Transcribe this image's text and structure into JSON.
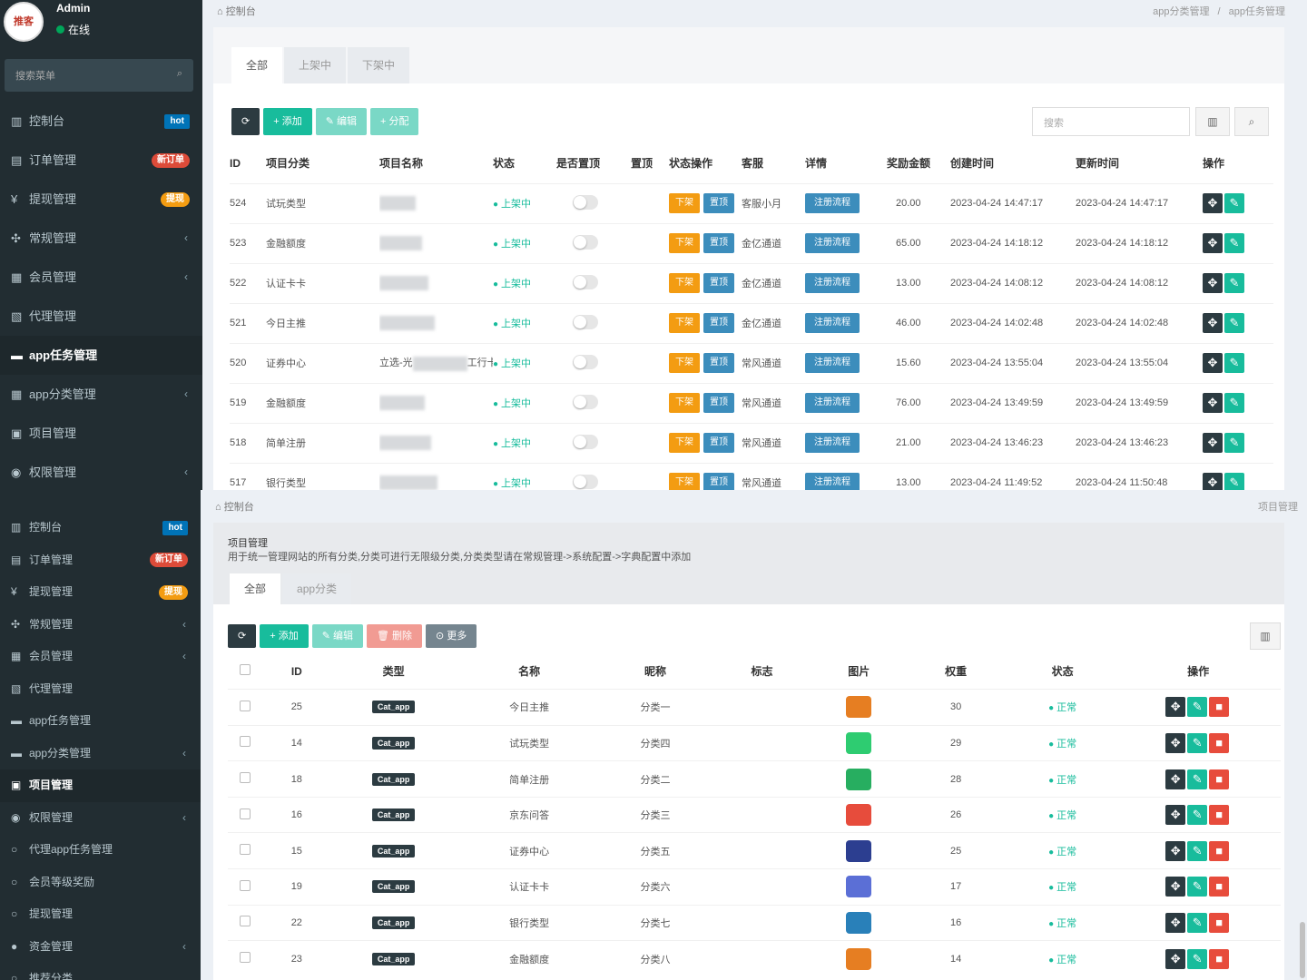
{
  "top": {
    "sidebar": {
      "avatar_text": "推客",
      "user_name": "Admin",
      "user_status": "在线",
      "search_placeholder": "搜索菜单",
      "items": [
        {
          "icon": "▥",
          "label": "控制台",
          "badge": "hot",
          "badge_kind": "hot"
        },
        {
          "icon": "▤",
          "label": "订单管理",
          "badge": "新订单",
          "badge_kind": "red"
        },
        {
          "icon": "¥",
          "label": "提现管理",
          "badge": "提现",
          "badge_kind": "orange"
        },
        {
          "icon": "✣",
          "label": "常规管理",
          "chevron": "‹"
        },
        {
          "icon": "▦",
          "label": "会员管理",
          "chevron": "‹"
        },
        {
          "icon": "▧",
          "label": "代理管理"
        },
        {
          "icon": "▬",
          "label": "app任务管理",
          "active": true
        },
        {
          "icon": "▦",
          "label": "app分类管理",
          "chevron": "‹"
        },
        {
          "icon": "▣",
          "label": "项目管理"
        },
        {
          "icon": "◉",
          "label": "权限管理",
          "chevron": "‹"
        }
      ]
    },
    "breadcrumb": "控制台",
    "breadcrumb_right": [
      "app分类管理",
      "/",
      "app任务管理"
    ],
    "tabs": [
      "全部",
      "上架中",
      "下架中"
    ],
    "toolbar": [
      "⟳",
      "+ 添加",
      "✎ 编辑",
      "+ 分配"
    ],
    "search_placeholder": "搜索",
    "columns": [
      "ID",
      "项目分类",
      "项目名称",
      "状态",
      "是否置顶",
      "置顶",
      "状态操作",
      "客服",
      "详情",
      "奖励金额",
      "创建时间",
      "更新时间",
      "操作"
    ],
    "rows": [
      {
        "id": "524",
        "category": "试玩类型",
        "status": "上架中",
        "down": "下架",
        "top": "置顶",
        "service": "客服小月",
        "detail": "注册流程",
        "amount": "20.00",
        "created": "2023-04-24 14:47:17",
        "updated": "2023-04-24 14:47:17"
      },
      {
        "id": "523",
        "category": "金融额度",
        "status": "上架中",
        "down": "下架",
        "top": "置顶",
        "service": "金亿通道",
        "detail": "注册流程",
        "amount": "65.00",
        "created": "2023-04-24 14:18:12",
        "updated": "2023-04-24 14:18:12"
      },
      {
        "id": "522",
        "category": "认证卡卡",
        "status": "上架中",
        "down": "下架",
        "top": "置顶",
        "service": "金亿通道",
        "detail": "注册流程",
        "amount": "13.00",
        "created": "2023-04-24 14:08:12",
        "updated": "2023-04-24 14:08:12"
      },
      {
        "id": "521",
        "category": "今日主推",
        "status": "上架中",
        "down": "下架",
        "top": "置顶",
        "service": "金亿通道",
        "detail": "注册流程",
        "amount": "46.00",
        "created": "2023-04-24 14:02:48",
        "updated": "2023-04-24 14:02:48"
      },
      {
        "id": "520",
        "category": "证券中心",
        "name_prefix": "立选-光",
        "name_suffix": "工行卡",
        "status": "上架中",
        "down": "下架",
        "top": "置顶",
        "service": "常风通道",
        "detail": "注册流程",
        "amount": "15.60",
        "created": "2023-04-24 13:55:04",
        "updated": "2023-04-24 13:55:04"
      },
      {
        "id": "519",
        "category": "金融额度",
        "status": "上架中",
        "down": "下架",
        "top": "置顶",
        "service": "常风通道",
        "detail": "注册流程",
        "amount": "76.00",
        "created": "2023-04-24 13:49:59",
        "updated": "2023-04-24 13:49:59"
      },
      {
        "id": "518",
        "category": "简单注册",
        "status": "上架中",
        "down": "下架",
        "top": "置顶",
        "service": "常风通道",
        "detail": "注册流程",
        "amount": "21.00",
        "created": "2023-04-24 13:46:23",
        "updated": "2023-04-24 13:46:23"
      },
      {
        "id": "517",
        "category": "银行类型",
        "status": "上架中",
        "down": "下架",
        "top": "置顶",
        "service": "常风通道",
        "detail": "注册流程",
        "amount": "13.00",
        "created": "2023-04-24 11:49:52",
        "updated": "2023-04-24 11:50:48"
      }
    ]
  },
  "bottom": {
    "sidebar": {
      "items": [
        {
          "icon": "▥",
          "label": "控制台",
          "badge": "hot",
          "badge_kind": "hot"
        },
        {
          "icon": "▤",
          "label": "订单管理",
          "badge": "新订单",
          "badge_kind": "red"
        },
        {
          "icon": "¥",
          "label": "提现管理",
          "badge": "提现",
          "badge_kind": "orange"
        },
        {
          "icon": "✣",
          "label": "常规管理",
          "chevron": "‹"
        },
        {
          "icon": "▦",
          "label": "会员管理",
          "chevron": "‹"
        },
        {
          "icon": "▧",
          "label": "代理管理"
        },
        {
          "icon": "▬",
          "label": "app任务管理"
        },
        {
          "icon": "▬",
          "label": "app分类管理",
          "chevron": "‹"
        },
        {
          "icon": "▣",
          "label": "项目管理",
          "active": true
        },
        {
          "icon": "◉",
          "label": "权限管理",
          "chevron": "‹"
        },
        {
          "icon": "○",
          "label": "代理app任务管理"
        },
        {
          "icon": "○",
          "label": "会员等级奖励"
        },
        {
          "icon": "○",
          "label": "提现管理"
        },
        {
          "icon": "●",
          "label": "资金管理",
          "chevron": "‹"
        },
        {
          "icon": "○",
          "label": "推荐分类"
        }
      ]
    },
    "breadcrumb": "控制台",
    "breadcrumb_right": "项目管理",
    "desc_title": "项目管理",
    "desc_text": "用于统一管理网站的所有分类,分类可进行无限级分类,分类类型请在常规管理->系统配置->字典配置中添加",
    "tabs": [
      "全部",
      "app分类"
    ],
    "toolbar": [
      "⟳",
      "+ 添加",
      "✎ 编辑",
      "🗑 删除",
      "⊙ 更多"
    ],
    "columns": [
      "",
      "ID",
      "类型",
      "名称",
      "昵称",
      "标志",
      "图片",
      "权重",
      "状态",
      "操作"
    ],
    "rows": [
      {
        "id": "25",
        "type": "Cat_app",
        "name": "今日主推",
        "nickname": "分类一",
        "img_color": "#e67e22",
        "weight": "30",
        "status": "正常"
      },
      {
        "id": "14",
        "type": "Cat_app",
        "name": "试玩类型",
        "nickname": "分类四",
        "img_color": "#2ecc71",
        "weight": "29",
        "status": "正常"
      },
      {
        "id": "18",
        "type": "Cat_app",
        "name": "简单注册",
        "nickname": "分类二",
        "img_color": "#27ae60",
        "weight": "28",
        "status": "正常"
      },
      {
        "id": "16",
        "type": "Cat_app",
        "name": "京东问答",
        "nickname": "分类三",
        "img_color": "#e74c3c",
        "weight": "26",
        "status": "正常"
      },
      {
        "id": "15",
        "type": "Cat_app",
        "name": "证券中心",
        "nickname": "分类五",
        "img_color": "#2c3e90",
        "weight": "25",
        "status": "正常"
      },
      {
        "id": "19",
        "type": "Cat_app",
        "name": "认证卡卡",
        "nickname": "分类六",
        "img_color": "#5b6fd6",
        "weight": "17",
        "status": "正常"
      },
      {
        "id": "22",
        "type": "Cat_app",
        "name": "银行类型",
        "nickname": "分类七",
        "img_color": "#2980b9",
        "weight": "16",
        "status": "正常"
      },
      {
        "id": "23",
        "type": "Cat_app",
        "name": "金融额度",
        "nickname": "分类八",
        "img_color": "#e67e22",
        "weight": "14",
        "status": "正常"
      }
    ]
  }
}
